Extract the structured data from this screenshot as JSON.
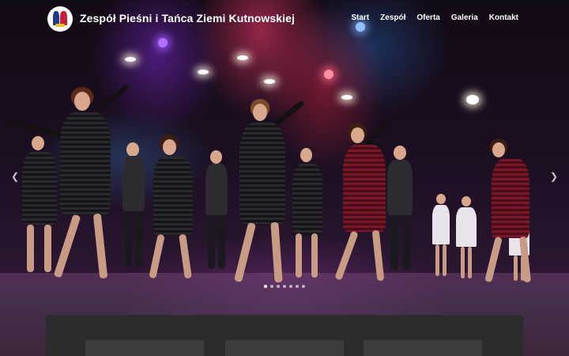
{
  "site": {
    "title": "Zespół Pieśni i Tańca Ziemi Kutnowskiej",
    "logo_icon": "dancers-logo-icon"
  },
  "nav": {
    "items": [
      {
        "label": "Start"
      },
      {
        "label": "Zespół"
      },
      {
        "label": "Oferta"
      },
      {
        "label": "Galeria"
      },
      {
        "label": "Kontakt"
      }
    ]
  },
  "slider": {
    "left_arrow_icon": "chevron-left-icon",
    "right_arrow_icon": "chevron-right-icon",
    "slide_count": 7,
    "active_slide": 1
  },
  "colors": {
    "header_text": "#ffffff",
    "panel_background": "#2c2c2e",
    "card_background": "#3d3d40"
  }
}
